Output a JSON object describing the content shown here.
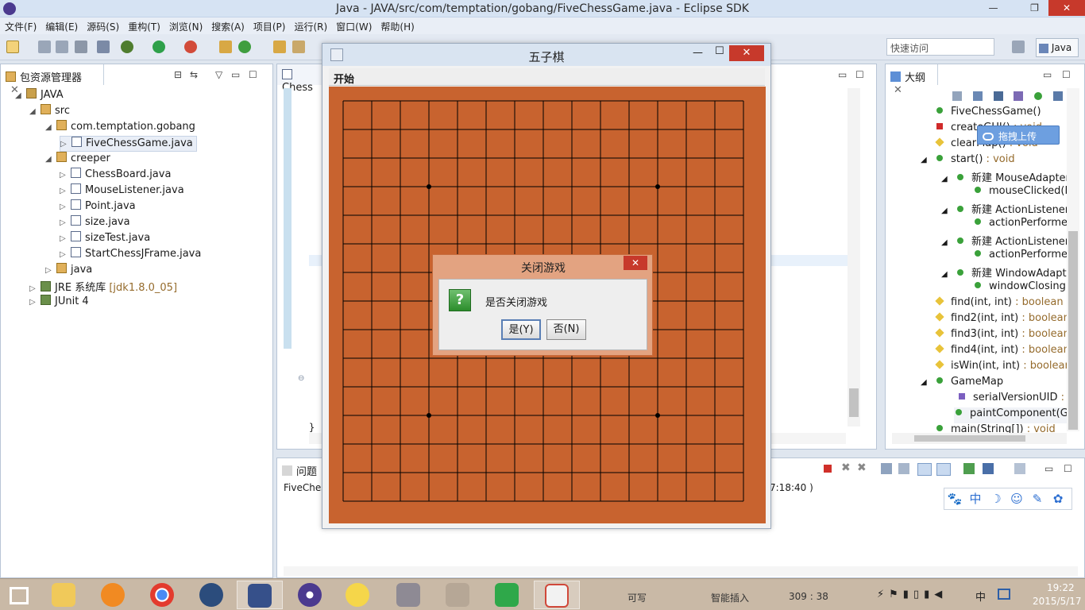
{
  "window": {
    "title": "Java  -  JAVA/src/com/temptation/gobang/FiveChessGame.java  -  Eclipse SDK"
  },
  "menu": [
    "文件(F)",
    "编辑(E)",
    "源码(S)",
    "重构(T)",
    "浏览(N)",
    "搜索(A)",
    "项目(P)",
    "运行(R)",
    "窗口(W)",
    "帮助(H)"
  ],
  "quick_access": {
    "placeholder": "快速访问"
  },
  "perspective": "Java",
  "package_explorer": {
    "tab": "包资源管理器",
    "items": [
      {
        "label": "JAVA",
        "suffix": ""
      },
      {
        "label": "src",
        "suffix": ""
      },
      {
        "label": "com.temptation.gobang",
        "suffix": ""
      },
      {
        "label": "FiveChessGame.java",
        "suffix": ""
      },
      {
        "label": "creeper",
        "suffix": ""
      },
      {
        "label": "ChessBoard.java",
        "suffix": ""
      },
      {
        "label": "MouseListener.java",
        "suffix": ""
      },
      {
        "label": "Point.java",
        "suffix": ""
      },
      {
        "label": "size.java",
        "suffix": ""
      },
      {
        "label": "sizeTest.java",
        "suffix": ""
      },
      {
        "label": "StartChessJFrame.java",
        "suffix": ""
      },
      {
        "label": "java",
        "suffix": ""
      },
      {
        "label": "JRE 系统库",
        "suffix": "[jdk1.8.0_05]"
      },
      {
        "label": "JUnit 4",
        "suffix": ""
      }
    ]
  },
  "editor": {
    "tab": "Chess",
    "closing_brace": "}"
  },
  "outline": {
    "tab": "大纲",
    "items": [
      {
        "name": "FiveChessGame()",
        "type": ""
      },
      {
        "name": "createGUI()",
        "type": " : void"
      },
      {
        "name": "clearMap()",
        "type": " : void"
      },
      {
        "name": "start()",
        "type": " : void"
      },
      {
        "name": "新建 MouseAdapter",
        "type": ""
      },
      {
        "name": "mouseClicked(I",
        "type": ""
      },
      {
        "name": "新建 ActionListener(",
        "type": ""
      },
      {
        "name": "actionPerforme",
        "type": ""
      },
      {
        "name": "新建 ActionListener(",
        "type": ""
      },
      {
        "name": "actionPerforme",
        "type": ""
      },
      {
        "name": "新建 WindowAdapte",
        "type": ""
      },
      {
        "name": "windowClosing",
        "type": ""
      },
      {
        "name": "find(int, int)",
        "type": " : boolean"
      },
      {
        "name": "find2(int, int)",
        "type": " : boolean"
      },
      {
        "name": "find3(int, int)",
        "type": " : boolean"
      },
      {
        "name": "find4(int, int)",
        "type": " : boolean"
      },
      {
        "name": "isWin(int, int)",
        "type": " : boolean"
      },
      {
        "name": "GameMap",
        "type": ""
      },
      {
        "name": "serialVersionUID",
        "type": " : l"
      },
      {
        "name": "paintComponent(Gr",
        "type": ""
      },
      {
        "name": "main(String[])",
        "type": " : void"
      }
    ]
  },
  "bottom_panel": {
    "tab": "问题",
    "line_left": "FiveChes",
    "line_right": "7:18:40 )"
  },
  "upload_button": "拖拽上传",
  "game": {
    "title": "五子棋",
    "menu_start": "开始",
    "board_color": "#c8632f",
    "grid_lines": 15,
    "star_points": 4
  },
  "dialog": {
    "title": "关闭游戏",
    "message": "是否关闭游戏",
    "yes": "是(Y)",
    "no": "否(N)"
  },
  "ime_bar": [
    "🐾",
    "中",
    "☽",
    "☺",
    "✎",
    "✿"
  ],
  "status": {
    "writable": "可写",
    "insert": "智能插入",
    "position": "309 : 38"
  },
  "clock": {
    "time": "19:22",
    "date": "2015/5/17"
  }
}
